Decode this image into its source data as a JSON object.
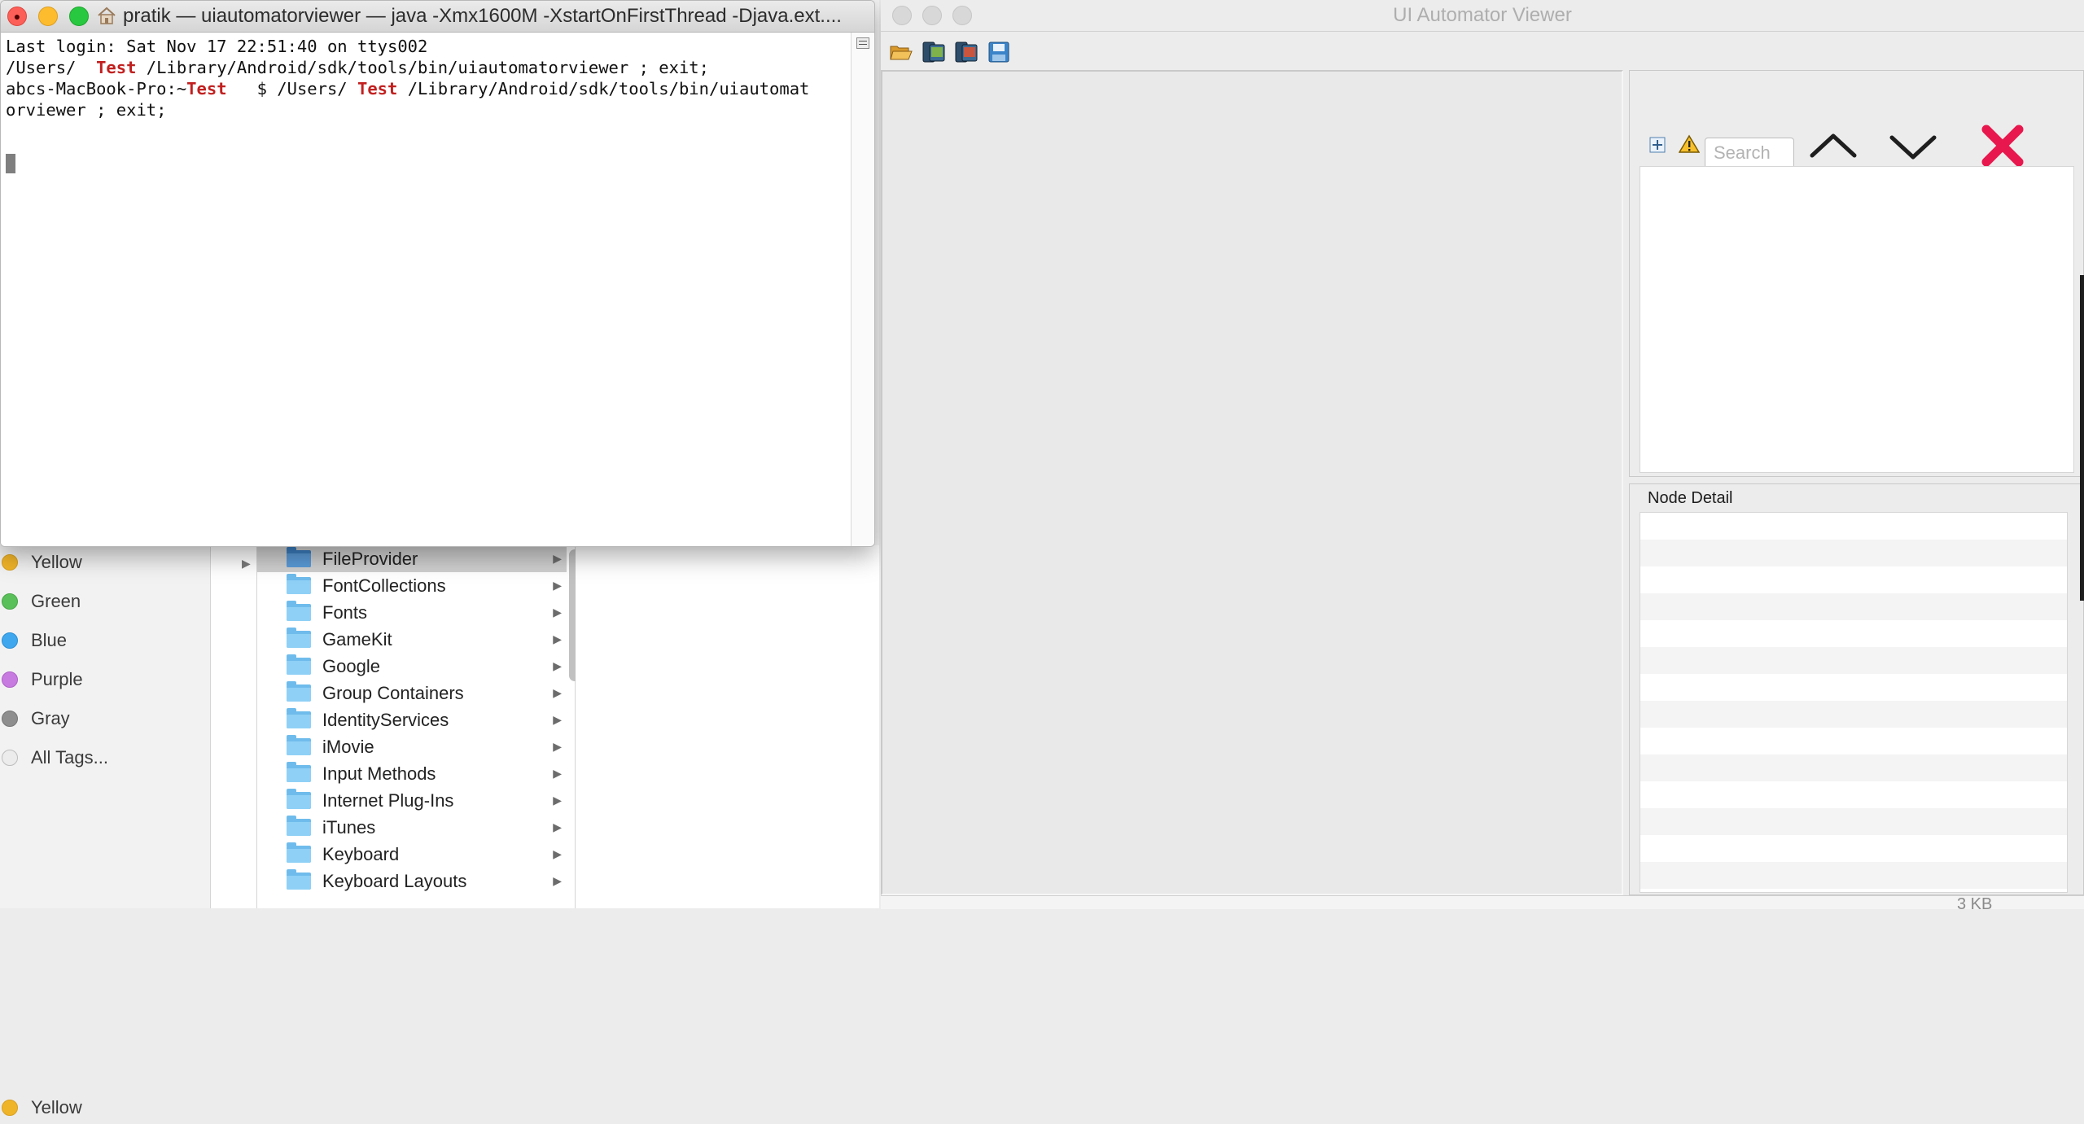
{
  "terminal": {
    "title": "pratik — uiautomatorviewer — java -Xmx1600M -XstartOnFirstThread -Djava.ext....",
    "lines": {
      "l1": "Last login: Sat Nov 17 22:51:40 on ttys002",
      "l2a": "/Users/",
      "l2b": "Test",
      "l2c": " /Library/Android/sdk/tools/bin/uiautomatorviewer ; exit;",
      "l3a": "abcs-MacBook-Pro:~",
      "l3b": "Test",
      "l3c": "   $ /Users/",
      "l3d": "Test",
      "l3e": " /Library/Android/sdk/tools/bin/uiautomat",
      "l4": "orviewer ; exit;"
    }
  },
  "finder": {
    "tags": [
      {
        "label": "Yellow",
        "color": "#f0b429"
      },
      {
        "label": "Green",
        "color": "#5ac05a"
      },
      {
        "label": "Blue",
        "color": "#3fa7ee"
      },
      {
        "label": "Purple",
        "color": "#c77be0"
      },
      {
        "label": "Gray",
        "color": "#8e8e8e"
      },
      {
        "label": "All Tags...",
        "color": "none"
      }
    ],
    "folders": [
      "FileProvider",
      "FontCollections",
      "Fonts",
      "GameKit",
      "Google",
      "Group Containers",
      "IdentityServices",
      "iMovie",
      "Input Methods",
      "Internet Plug-Ins",
      "iTunes",
      "Keyboard",
      "Keyboard Layouts"
    ],
    "selected_folder": "FileProvider",
    "file_size": "3 KB"
  },
  "uiautomator": {
    "title": "UI Automator Viewer",
    "search_placeholder": "Search",
    "node_detail_label": "Node Detail",
    "toolbar_icons": [
      "open-folder-icon",
      "device-screenshot-icon",
      "device-screenshot-compressed-icon",
      "save-icon"
    ],
    "accent_clear": "#e8174d"
  }
}
